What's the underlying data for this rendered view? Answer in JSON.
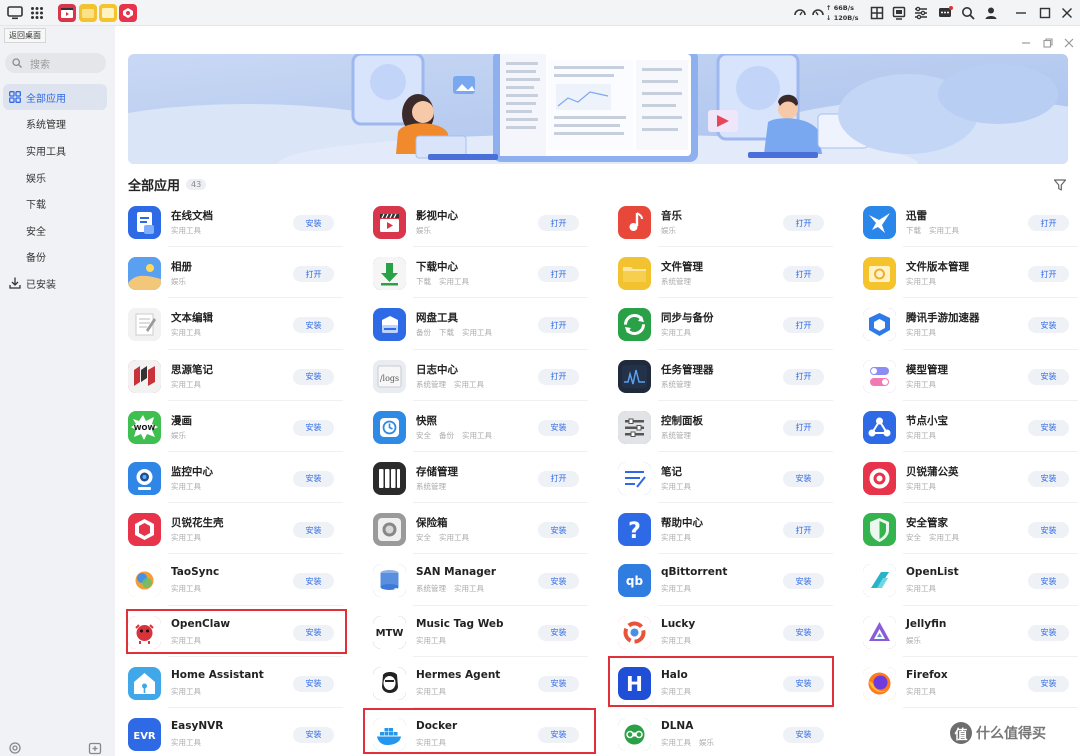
{
  "topbar": {
    "tooltip": "返回桌面",
    "net_up": "66B/s",
    "net_down": "120B/s",
    "cpu_label": "CPU",
    "ram_label": "RAM"
  },
  "sidebar": {
    "search_placeholder": "搜索",
    "items": [
      {
        "label": "全部应用",
        "active": true
      },
      {
        "label": "系统管理"
      },
      {
        "label": "实用工具"
      },
      {
        "label": "娱乐"
      },
      {
        "label": "下载"
      },
      {
        "label": "安全"
      },
      {
        "label": "备份"
      },
      {
        "label": "已安装"
      }
    ]
  },
  "main": {
    "section_title": "全部应用",
    "count": "43"
  },
  "apps": [
    {
      "name": "在线文档",
      "tags": [
        "实用工具"
      ],
      "action": "安装",
      "icon": "document-icon",
      "color": "#2f6ae6"
    },
    {
      "name": "影视中心",
      "tags": [
        "娱乐"
      ],
      "action": "打开",
      "icon": "clapperboard-icon",
      "color": "#d9354b"
    },
    {
      "name": "音乐",
      "tags": [
        "娱乐"
      ],
      "action": "打开",
      "icon": "music-note-icon",
      "color": "#e8483a"
    },
    {
      "name": "迅雷",
      "tags": [
        "下载",
        "实用工具"
      ],
      "action": "打开",
      "icon": "thunder-bird-icon",
      "color": "#2b86ea"
    },
    {
      "name": "相册",
      "tags": [
        "娱乐"
      ],
      "action": "打开",
      "icon": "photo-icon",
      "color": "#3d8be8"
    },
    {
      "name": "下载中心",
      "tags": [
        "下载",
        "实用工具"
      ],
      "action": "打开",
      "icon": "download-arrow-icon",
      "color": "#2aa146"
    },
    {
      "name": "文件管理",
      "tags": [
        "系统管理"
      ],
      "action": "打开",
      "icon": "folder-icon",
      "color": "#f2c230"
    },
    {
      "name": "文件版本管理",
      "tags": [
        "实用工具"
      ],
      "action": "打开",
      "icon": "version-folder-icon",
      "color": "#f5c42d"
    },
    {
      "name": "文本编辑",
      "tags": [
        "实用工具"
      ],
      "action": "安装",
      "icon": "notepad-icon",
      "color": "#d9d9d9"
    },
    {
      "name": "网盘工具",
      "tags": [
        "备份",
        "下载",
        "实用工具"
      ],
      "action": "打开",
      "icon": "cloud-drive-icon",
      "color": "#2f6ae6"
    },
    {
      "name": "同步与备份",
      "tags": [
        "实用工具"
      ],
      "action": "打开",
      "icon": "sync-icon",
      "color": "#2aa146"
    },
    {
      "name": "腾讯手游加速器",
      "tags": [
        "实用工具"
      ],
      "action": "安装",
      "icon": "game-booster-icon",
      "color": "#2d7ae8"
    },
    {
      "name": "思源笔记",
      "tags": [
        "实用工具"
      ],
      "action": "安装",
      "icon": "siyuan-icon",
      "color": "#c8333b"
    },
    {
      "name": "日志中心",
      "tags": [
        "系统管理",
        "实用工具"
      ],
      "action": "打开",
      "icon": "logs-icon",
      "color": "#e8e8e8"
    },
    {
      "name": "任务管理器",
      "tags": [
        "系统管理"
      ],
      "action": "打开",
      "icon": "activity-monitor-icon",
      "color": "#1f2a3c"
    },
    {
      "name": "模型管理",
      "tags": [
        "实用工具"
      ],
      "action": "安装",
      "icon": "toggle-switch-icon",
      "color": "#6b6bf0"
    },
    {
      "name": "漫画",
      "tags": [
        "娱乐"
      ],
      "action": "安装",
      "icon": "comic-wow-icon",
      "color": "#3fbf4f"
    },
    {
      "name": "快照",
      "tags": [
        "安全",
        "备份",
        "实用工具"
      ],
      "action": "安装",
      "icon": "clock-icon",
      "color": "#2f8ae6"
    },
    {
      "name": "控制面板",
      "tags": [
        "系统管理"
      ],
      "action": "打开",
      "icon": "control-panel-icon",
      "color": "#6e6e73"
    },
    {
      "name": "节点小宝",
      "tags": [
        "实用工具"
      ],
      "action": "安装",
      "icon": "node-icon",
      "color": "#2f6ae6"
    },
    {
      "name": "监控中心",
      "tags": [
        "实用工具"
      ],
      "action": "安装",
      "icon": "camera-icon",
      "color": "#2f86e6"
    },
    {
      "name": "存储管理",
      "tags": [
        "系统管理"
      ],
      "action": "打开",
      "icon": "storage-icon",
      "color": "#2b2b2b"
    },
    {
      "name": "笔记",
      "tags": [
        "实用工具"
      ],
      "action": "安装",
      "icon": "note-lines-icon",
      "color": "#2f6ae6"
    },
    {
      "name": "贝锐蒲公英",
      "tags": [
        "实用工具"
      ],
      "action": "安装",
      "icon": "dandelion-icon",
      "color": "#e8344a"
    },
    {
      "name": "贝锐花生壳",
      "tags": [
        "实用工具"
      ],
      "action": "安装",
      "icon": "peanut-shell-icon",
      "color": "#e8344a"
    },
    {
      "name": "保险箱",
      "tags": [
        "安全",
        "实用工具"
      ],
      "action": "安装",
      "icon": "safe-icon",
      "color": "#9a9a9a"
    },
    {
      "name": "帮助中心",
      "tags": [
        "实用工具"
      ],
      "action": "打开",
      "icon": "help-icon",
      "color": "#2f6ae6"
    },
    {
      "name": "安全管家",
      "tags": [
        "安全",
        "实用工具"
      ],
      "action": "安装",
      "icon": "shield-icon",
      "color": "#34b34f"
    },
    {
      "name": "TaoSync",
      "tags": [
        "实用工具"
      ],
      "action": "安装",
      "icon": "taosync-icon",
      "color": "#f39c3a"
    },
    {
      "name": "SAN Manager",
      "tags": [
        "系统管理",
        "实用工具"
      ],
      "action": "安装",
      "icon": "san-icon",
      "color": "#3a7ad9"
    },
    {
      "name": "qBittorrent",
      "tags": [
        "实用工具"
      ],
      "action": "安装",
      "icon": "qbittorrent-icon",
      "color": "#2f7de0"
    },
    {
      "name": "OpenList",
      "tags": [
        "实用工具"
      ],
      "action": "安装",
      "icon": "openlist-icon",
      "color": "#28b3c9"
    },
    {
      "name": "OpenClaw",
      "tags": [
        "实用工具"
      ],
      "action": "安装",
      "icon": "openclaw-icon",
      "color": "#d8323b"
    },
    {
      "name": "Music Tag Web",
      "tags": [
        "实用工具"
      ],
      "action": "安装",
      "icon": "mtw-icon",
      "color": "#222222"
    },
    {
      "name": "Lucky",
      "tags": [
        "实用工具"
      ],
      "action": "安装",
      "icon": "lucky-icon",
      "color": "#e8533a"
    },
    {
      "name": "Jellyfin",
      "tags": [
        "娱乐"
      ],
      "action": "安装",
      "icon": "jellyfin-icon",
      "color": "#8a5cd6"
    },
    {
      "name": "Home Assistant",
      "tags": [
        "实用工具"
      ],
      "action": "安装",
      "icon": "home-assistant-icon",
      "color": "#40a8e8"
    },
    {
      "name": "Hermes Agent",
      "tags": [
        "实用工具"
      ],
      "action": "安装",
      "icon": "hermes-icon",
      "color": "#222222"
    },
    {
      "name": "Halo",
      "tags": [
        "实用工具"
      ],
      "action": "安装",
      "icon": "halo-icon",
      "color": "#1f4fd6"
    },
    {
      "name": "Firefox",
      "tags": [
        "实用工具"
      ],
      "action": "安装",
      "icon": "firefox-icon",
      "color": "#ff7a1a"
    },
    {
      "name": "EasyNVR",
      "tags": [
        "实用工具"
      ],
      "action": "安装",
      "icon": "easynvr-icon",
      "color": "#2f6ae6"
    },
    {
      "name": "Docker",
      "tags": [
        "实用工具"
      ],
      "action": "安装",
      "icon": "docker-icon",
      "color": "#2496ed"
    },
    {
      "name": "DLNA",
      "tags": [
        "实用工具",
        "娱乐"
      ],
      "action": "安装",
      "icon": "dlna-icon",
      "color": "#2aa146"
    }
  ],
  "watermark": "什么值得买",
  "colors": {
    "accent": "#2f6ae6",
    "highlight": "#e0303a",
    "sidebar_bg": "#f1f2f5"
  }
}
